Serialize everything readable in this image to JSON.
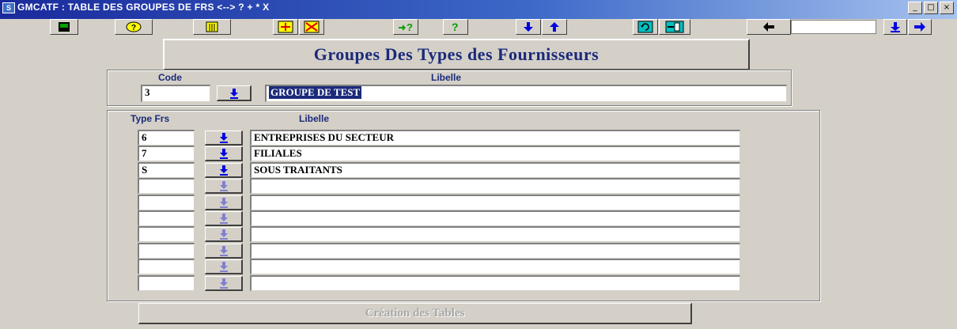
{
  "window": {
    "title": "GMCATF : TABLE DES GROUPES DE FRS <--> ? + * X",
    "controls": [
      "_",
      "□",
      "×"
    ]
  },
  "toolbar": {
    "icons": [
      "save-icon",
      "query-icon",
      "trash-icon",
      "insert-record-icon",
      "delete-record-icon",
      "help-arrow-icon",
      "help-icon",
      "arrow-down-icon",
      "arrow-up-icon",
      "refresh-icon",
      "exit-door-icon",
      "arrow-left-icon",
      "arrow-down-icon",
      "arrow-right-icon"
    ],
    "search_value": ""
  },
  "heading": "Groupes  Des Types des  Fournisseurs",
  "group": {
    "code_label": "Code",
    "libelle_label": "Libelle",
    "code_value": "3",
    "libelle_value": "GROUPE DE TEST"
  },
  "table": {
    "col_type": "Type Frs",
    "col_libelle": "Libelle",
    "rows": [
      {
        "type": "6",
        "libelle": "ENTREPRISES DU SECTEUR"
      },
      {
        "type": "7",
        "libelle": "FILIALES"
      },
      {
        "type": "S",
        "libelle": "SOUS TRAITANTS"
      },
      {
        "type": "",
        "libelle": ""
      },
      {
        "type": "",
        "libelle": ""
      },
      {
        "type": "",
        "libelle": ""
      },
      {
        "type": "",
        "libelle": ""
      },
      {
        "type": "",
        "libelle": ""
      },
      {
        "type": "",
        "libelle": ""
      },
      {
        "type": "",
        "libelle": ""
      }
    ]
  },
  "footer_button": "Création des Tables",
  "colors": {
    "accent": "#1b2a7a",
    "toolbar_icon_green": "#00a000",
    "toolbar_icon_yellow": "#ffff00"
  }
}
